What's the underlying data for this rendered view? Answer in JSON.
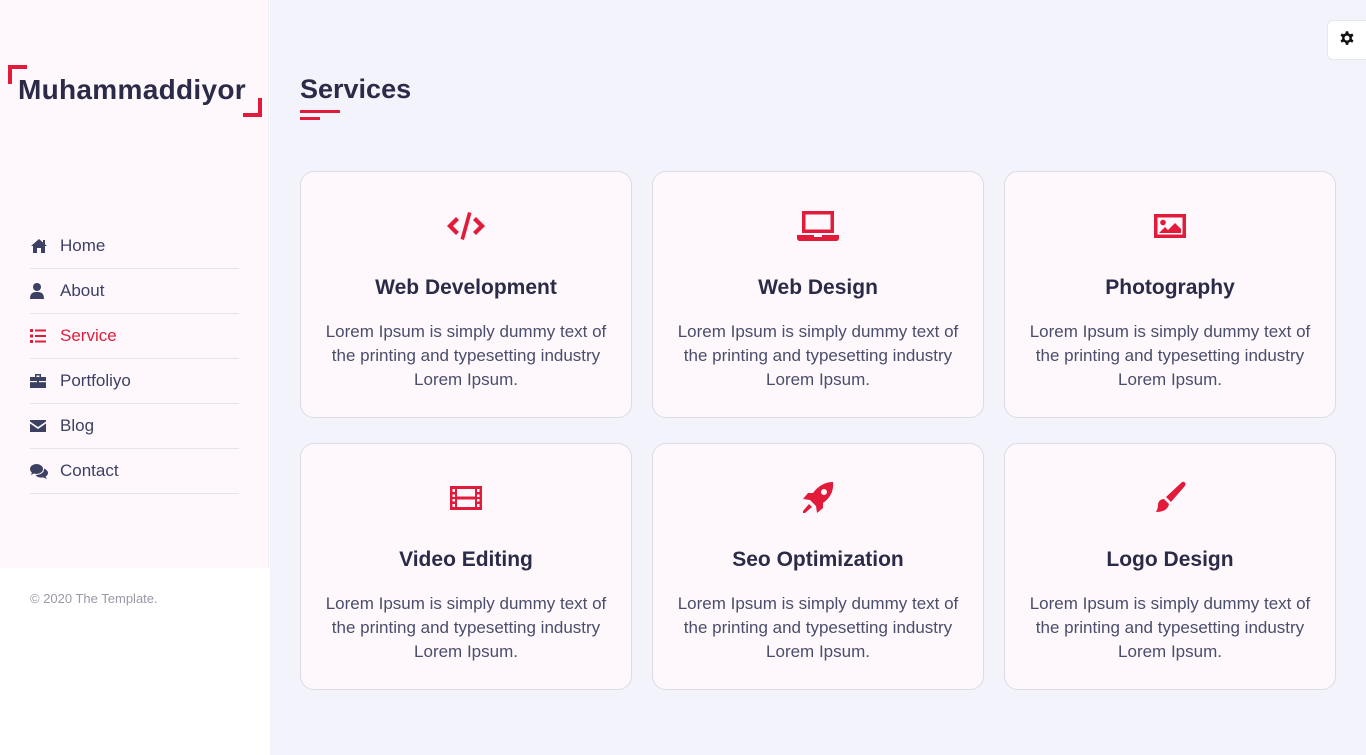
{
  "brand": {
    "name": "Muhammaddiyor"
  },
  "nav": [
    {
      "label": "Home",
      "icon": "home-icon",
      "active": false
    },
    {
      "label": "About",
      "icon": "user-icon",
      "active": false
    },
    {
      "label": "Service",
      "icon": "list-icon",
      "active": true
    },
    {
      "label": "Portfoliyo",
      "icon": "briefcase-icon",
      "active": false
    },
    {
      "label": "Blog",
      "icon": "envelope-icon",
      "active": false
    },
    {
      "label": "Contact",
      "icon": "comments-icon",
      "active": false
    }
  ],
  "footer": {
    "copyright": "© 2020 The Template."
  },
  "page": {
    "title": "Services"
  },
  "services": [
    {
      "title": "Web Development",
      "icon": "code-icon",
      "description": "Lorem Ipsum is simply dummy text of the printing and typesetting industry Lorem Ipsum."
    },
    {
      "title": "Web Design",
      "icon": "laptop-icon",
      "description": "Lorem Ipsum is simply dummy text of the printing and typesetting industry Lorem Ipsum."
    },
    {
      "title": "Photography",
      "icon": "image-icon",
      "description": "Lorem Ipsum is simply dummy text of the printing and typesetting industry Lorem Ipsum."
    },
    {
      "title": "Video Editing",
      "icon": "film-icon",
      "description": "Lorem Ipsum is simply dummy text of the printing and typesetting industry Lorem Ipsum."
    },
    {
      "title": "Seo Optimization",
      "icon": "rocket-icon",
      "description": "Lorem Ipsum is simply dummy text of the printing and typesetting industry Lorem Ipsum."
    },
    {
      "title": "Logo Design",
      "icon": "paint-brush-icon",
      "description": "Lorem Ipsum is simply dummy text of the printing and typesetting industry Lorem Ipsum."
    }
  ],
  "colors": {
    "accent": "#e31b3a",
    "text": "#2b2b48",
    "background": "#f2f3fb"
  }
}
